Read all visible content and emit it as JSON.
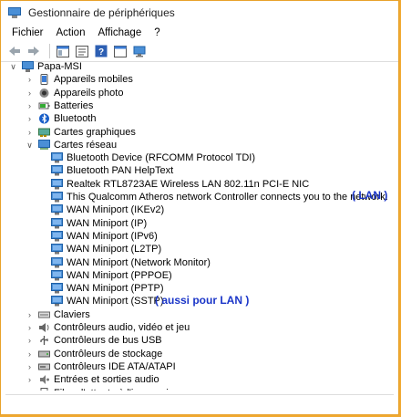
{
  "window": {
    "title": "Gestionnaire de périphériques"
  },
  "menu": [
    "Fichier",
    "Action",
    "Affichage",
    "?"
  ],
  "tree": {
    "root": "Papa-MSI",
    "categories_top": [
      {
        "label": "Appareils mobiles",
        "icon": "phone-icon"
      },
      {
        "label": "Appareils photo",
        "icon": "camera-icon"
      },
      {
        "label": "Batteries",
        "icon": "battery-icon"
      },
      {
        "label": "Bluetooth",
        "icon": "bluetooth-icon"
      },
      {
        "label": "Cartes graphiques",
        "icon": "display-adapter-icon"
      }
    ],
    "network": {
      "label": "Cartes réseau",
      "children": [
        "Bluetooth Device (RFCOMM Protocol TDI)",
        "Bluetooth PAN HelpText",
        "Realtek RTL8723AE Wireless LAN 802.11n PCI-E NIC",
        "This Qualcomm Atheros network Controller connects you to the network.",
        "WAN Miniport (IKEv2)",
        "WAN Miniport (IP)",
        "WAN Miniport (IPv6)",
        "WAN Miniport (L2TP)",
        "WAN Miniport (Network Monitor)",
        "WAN Miniport (PPPOE)",
        "WAN Miniport (PPTP)",
        "WAN Miniport (SSTP)"
      ]
    },
    "categories_bottom": [
      {
        "label": "Claviers",
        "icon": "keyboard-icon"
      },
      {
        "label": "Contrôleurs audio, vidéo et jeu",
        "icon": "speaker-icon"
      },
      {
        "label": "Contrôleurs de bus USB",
        "icon": "usb-icon"
      },
      {
        "label": "Contrôleurs de stockage",
        "icon": "storage-icon"
      },
      {
        "label": "Contrôleurs IDE ATA/ATAPI",
        "icon": "ide-icon"
      },
      {
        "label": "Entrées et sorties audio",
        "icon": "audio-io-icon"
      },
      {
        "label": "Files d'attente à l'impression :",
        "icon": "printer-icon"
      }
    ]
  },
  "annotations": {
    "lan": "( LAN )",
    "aussi": "( aussi  pour  LAN )"
  },
  "colors": {
    "accent": "#1a35c8",
    "frame": "#f0a830"
  }
}
